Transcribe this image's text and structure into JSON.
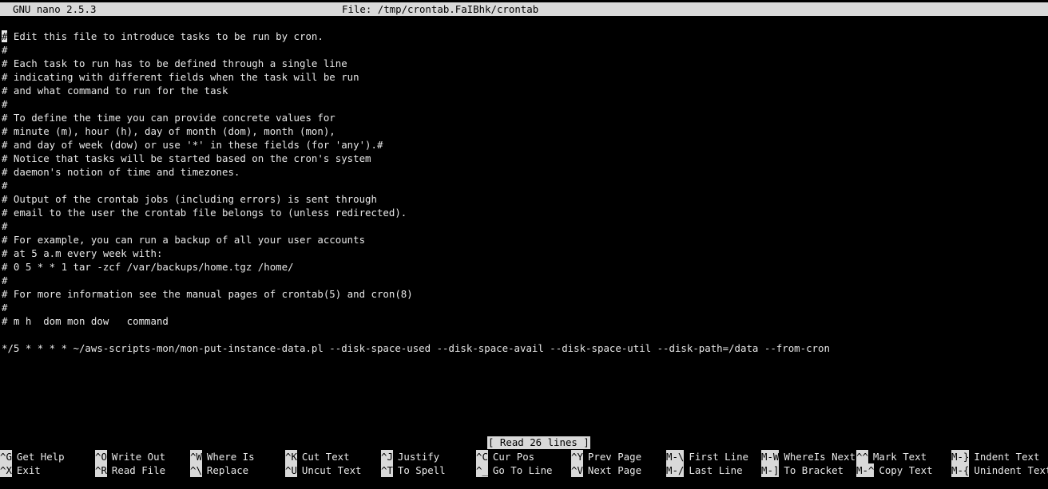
{
  "titlebar": {
    "app": "GNU nano 2.5.3",
    "file": "File: /tmp/crontab.FaIBhk/crontab"
  },
  "editor": {
    "first_line_cursor_char": "#",
    "lines": [
      "# Edit this file to introduce tasks to be run by cron.",
      "#",
      "# Each task to run has to be defined through a single line",
      "# indicating with different fields when the task will be run",
      "# and what command to run for the task",
      "#",
      "# To define the time you can provide concrete values for",
      "# minute (m), hour (h), day of month (dom), month (mon),",
      "# and day of week (dow) or use '*' in these fields (for 'any').#",
      "# Notice that tasks will be started based on the cron's system",
      "# daemon's notion of time and timezones.",
      "#",
      "# Output of the crontab jobs (including errors) is sent through",
      "# email to the user the crontab file belongs to (unless redirected).",
      "#",
      "# For example, you can run a backup of all your user accounts",
      "# at 5 a.m every week with:",
      "# 0 5 * * 1 tar -zcf /var/backups/home.tgz /home/",
      "#",
      "# For more information see the manual pages of crontab(5) and cron(8)",
      "#",
      "# m h  dom mon dow   command",
      "",
      "*/5 * * * * ~/aws-scripts-mon/mon-put-instance-data.pl --disk-space-used --disk-space-avail --disk-space-util --disk-path=/data --from-cron"
    ]
  },
  "status": "[ Read 26 lines ]",
  "shortcuts": {
    "row1": [
      {
        "key": "^G",
        "label": "Get Help"
      },
      {
        "key": "^O",
        "label": "Write Out"
      },
      {
        "key": "^W",
        "label": "Where Is"
      },
      {
        "key": "^K",
        "label": "Cut Text"
      },
      {
        "key": "^J",
        "label": "Justify"
      },
      {
        "key": "^C",
        "label": "Cur Pos"
      },
      {
        "key": "^Y",
        "label": "Prev Page"
      },
      {
        "key": "M-\\",
        "label": "First Line"
      },
      {
        "key": "M-W",
        "label": "WhereIs Next"
      },
      {
        "key": "^^",
        "label": "Mark Text"
      },
      {
        "key": "M-}",
        "label": "Indent Text"
      }
    ],
    "row2": [
      {
        "key": "^X",
        "label": "Exit"
      },
      {
        "key": "^R",
        "label": "Read File"
      },
      {
        "key": "^\\",
        "label": "Replace"
      },
      {
        "key": "^U",
        "label": "Uncut Text"
      },
      {
        "key": "^T",
        "label": "To Spell"
      },
      {
        "key": "^_",
        "label": "Go To Line"
      },
      {
        "key": "^V",
        "label": "Next Page"
      },
      {
        "key": "M-/",
        "label": "Last Line"
      },
      {
        "key": "M-]",
        "label": "To Bracket"
      },
      {
        "key": "M-^",
        "label": "Copy Text"
      },
      {
        "key": "M-{",
        "label": "Unindent Text"
      }
    ]
  },
  "colors": {
    "background": "#000000",
    "foreground": "#e8e8e8",
    "inverse_bg": "#d9d9d9",
    "inverse_fg": "#000000"
  }
}
